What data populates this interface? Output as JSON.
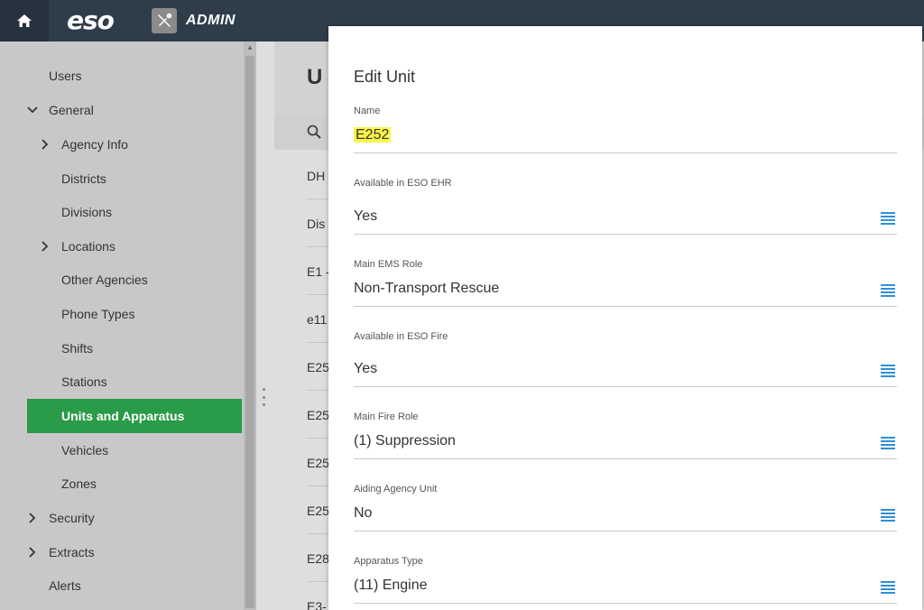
{
  "header": {
    "logo_text": "eso",
    "admin_label": "ADMIN",
    "home_icon": "home-icon",
    "tools_icon": "tools-icon"
  },
  "sidebar": {
    "items": [
      {
        "label": "Users",
        "chevron": ""
      },
      {
        "label": "General",
        "chevron": "expanded"
      },
      {
        "label": "Agency Info",
        "chevron": "collapsed"
      },
      {
        "label": "Districts",
        "chevron": ""
      },
      {
        "label": "Divisions",
        "chevron": ""
      },
      {
        "label": "Locations",
        "chevron": "collapsed"
      },
      {
        "label": "Other Agencies",
        "chevron": ""
      },
      {
        "label": "Phone Types",
        "chevron": ""
      },
      {
        "label": "Shifts",
        "chevron": ""
      },
      {
        "label": "Stations",
        "chevron": ""
      },
      {
        "label": "Units and Apparatus",
        "chevron": "",
        "active": true
      },
      {
        "label": "Vehicles",
        "chevron": ""
      },
      {
        "label": "Zones",
        "chevron": ""
      },
      {
        "label": "Security",
        "chevron": "collapsed"
      },
      {
        "label": "Extracts",
        "chevron": "collapsed"
      },
      {
        "label": "Alerts",
        "chevron": ""
      }
    ],
    "active_color": "#2a9b48"
  },
  "main": {
    "title_partial": "U",
    "list_partial": [
      "DH",
      "Dis",
      "E1 -",
      "e11",
      "E25",
      "E25",
      "E25",
      "E25",
      "E28",
      "E3-"
    ]
  },
  "modal": {
    "title": "Edit Unit",
    "fields": [
      {
        "label": "Name",
        "value": "E252",
        "highlighted": true,
        "has_picker": false
      },
      {
        "label": "Available in ESO EHR",
        "value": "Yes",
        "has_picker": true
      },
      {
        "label": "Main EMS Role",
        "value": "Non-Transport Rescue",
        "has_picker": true
      },
      {
        "label": "Available in ESO Fire",
        "value": "Yes",
        "has_picker": true
      },
      {
        "label": "Main Fire Role",
        "value": "(1) Suppression",
        "has_picker": true
      },
      {
        "label": "Aiding Agency Unit",
        "value": "No",
        "has_picker": true
      },
      {
        "label": "Apparatus Type",
        "value": "(11) Engine",
        "has_picker": true
      }
    ],
    "picker_icon": "list-icon",
    "picker_color": "#2e90d6",
    "highlight_color": "#fbf64a"
  }
}
